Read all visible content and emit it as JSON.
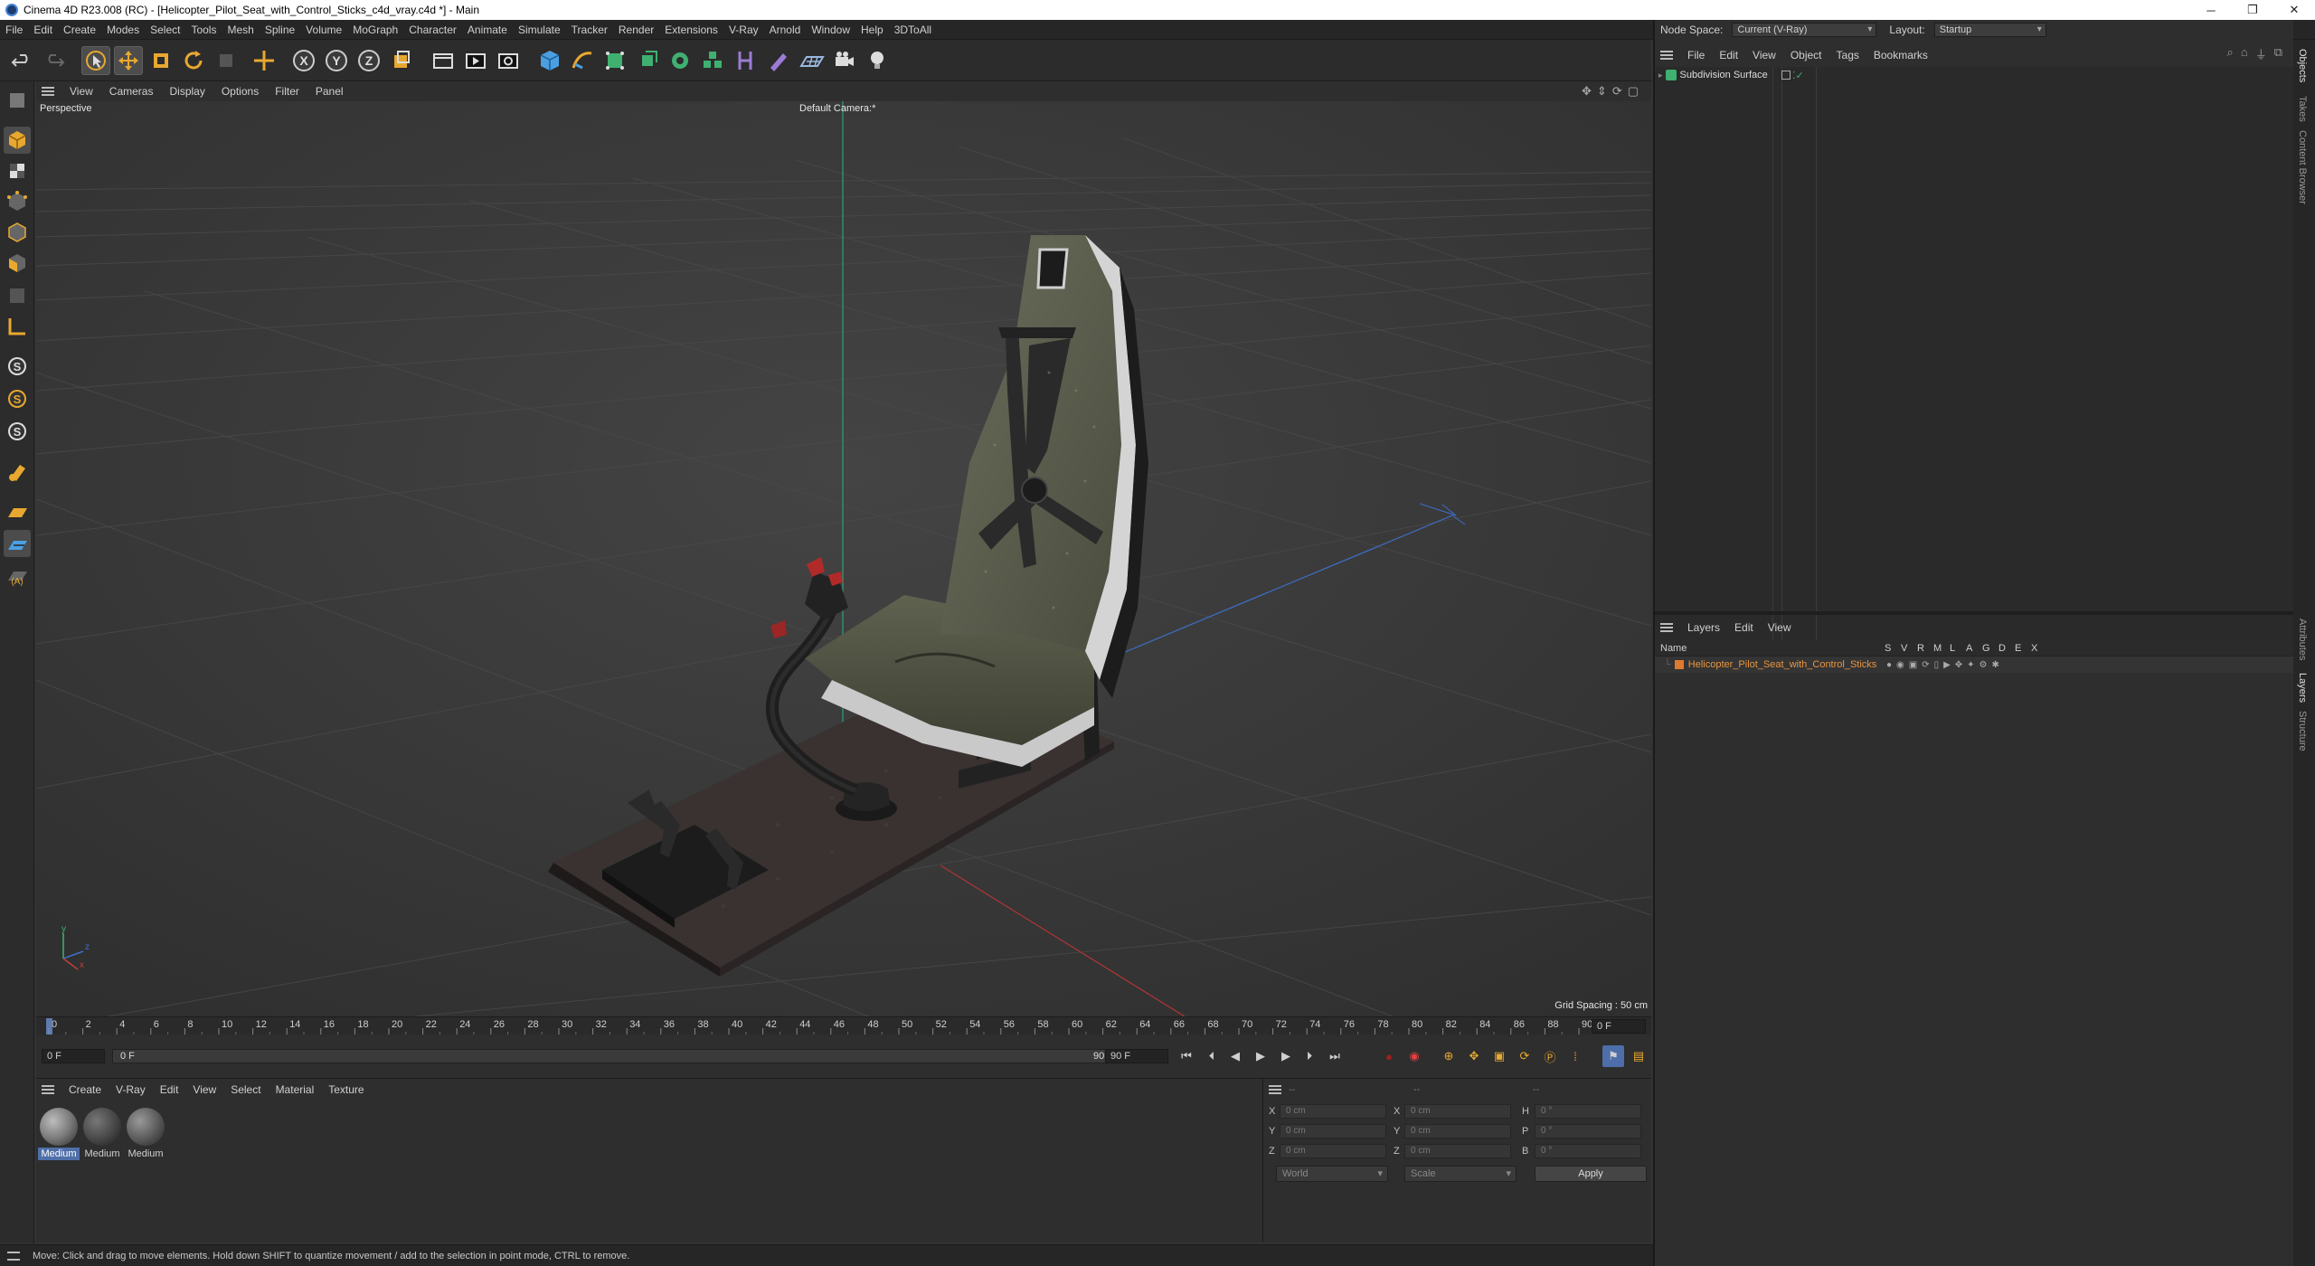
{
  "window": {
    "title": "Cinema 4D R23.008 (RC) - [Helicopter_Pilot_Seat_with_Control_Sticks_c4d_vray.c4d *] - Main",
    "minimize": "─",
    "maximize": "❐",
    "close": "✕"
  },
  "menubar": {
    "items": [
      "File",
      "Edit",
      "Create",
      "Modes",
      "Select",
      "Tools",
      "Mesh",
      "Spline",
      "Volume",
      "MoGraph",
      "Character",
      "Animate",
      "Simulate",
      "Tracker",
      "Render",
      "Extensions",
      "V-Ray",
      "Arnold",
      "Window",
      "Help",
      "3DToAll"
    ],
    "node_space_label": "Node Space:",
    "node_space_value": "Current (V-Ray)",
    "layout_label": "Layout:",
    "layout_value": "Startup"
  },
  "viewport": {
    "menu": [
      "View",
      "Cameras",
      "Display",
      "Options",
      "Filter",
      "Panel"
    ],
    "perspective_label": "Perspective",
    "camera_label": "Default Camera:*",
    "grid_spacing": "Grid Spacing : 50 cm",
    "axis_y": "y",
    "axis_z": "z",
    "axis_x": "x"
  },
  "timeline": {
    "ticks": [
      "0",
      "2",
      "4",
      "6",
      "8",
      "10",
      "12",
      "14",
      "16",
      "18",
      "20",
      "22",
      "24",
      "26",
      "28",
      "30",
      "32",
      "34",
      "36",
      "38",
      "40",
      "42",
      "44",
      "46",
      "48",
      "50",
      "52",
      "54",
      "56",
      "58",
      "60",
      "62",
      "64",
      "66",
      "68",
      "70",
      "72",
      "74",
      "76",
      "78",
      "80",
      "82",
      "84",
      "86",
      "88",
      "90"
    ],
    "current_frame": "0 F",
    "start_field": "0 F",
    "range_start": "0 F",
    "range_end": "90 F",
    "end_field": "90 F"
  },
  "materials": {
    "menu": [
      "Create",
      "V-Ray",
      "Edit",
      "View",
      "Select",
      "Material",
      "Texture"
    ],
    "items": [
      {
        "label": "Medium",
        "color": "#7b7b7b",
        "selected": true
      },
      {
        "label": "Medium",
        "color": "#4a4a4a",
        "selected": false
      },
      {
        "label": "Medium",
        "color": "#5e5e5e",
        "selected": false
      }
    ]
  },
  "coordinates": {
    "menu": [
      "--",
      "--",
      "--"
    ],
    "pos": {
      "x": "0 cm",
      "y": "0 cm",
      "z": "0 cm"
    },
    "size": {
      "x": "0 cm",
      "y": "0 cm",
      "z": "0 cm"
    },
    "rot": {
      "h": "0 °",
      "p": "0 °",
      "b": "0 °"
    },
    "labels": {
      "x": "X",
      "y": "Y",
      "z": "Z",
      "h": "H",
      "p": "P",
      "b": "B"
    },
    "world": "World",
    "scale": "Scale",
    "apply": "Apply"
  },
  "status": {
    "text": "Move: Click and drag to move elements. Hold down SHIFT to quantize movement / add to the selection in point mode, CTRL to remove."
  },
  "objects": {
    "menu": [
      "File",
      "Edit",
      "View",
      "Object",
      "Tags",
      "Bookmarks"
    ],
    "rows": [
      {
        "name": "Subdivision Surface"
      }
    ]
  },
  "layers": {
    "menu": [
      "Layers",
      "Edit",
      "View"
    ],
    "header_name": "Name",
    "header_flags": [
      "S",
      "V",
      "R",
      "M",
      "L",
      "A",
      "G",
      "D",
      "E",
      "X"
    ],
    "rows": [
      {
        "name": "Helicopter_Pilot_Seat_with_Control_Sticks",
        "color": "#e07a30"
      }
    ]
  },
  "side_tabs": [
    "Objects",
    "Takes",
    "Content Browser",
    "Attributes",
    "Layers",
    "Structure"
  ],
  "colors": {
    "accent": "#4f7fd0",
    "layer_text": "#e8953f",
    "viewport_bg": "#3b3b3b",
    "seat": "#565a48"
  }
}
